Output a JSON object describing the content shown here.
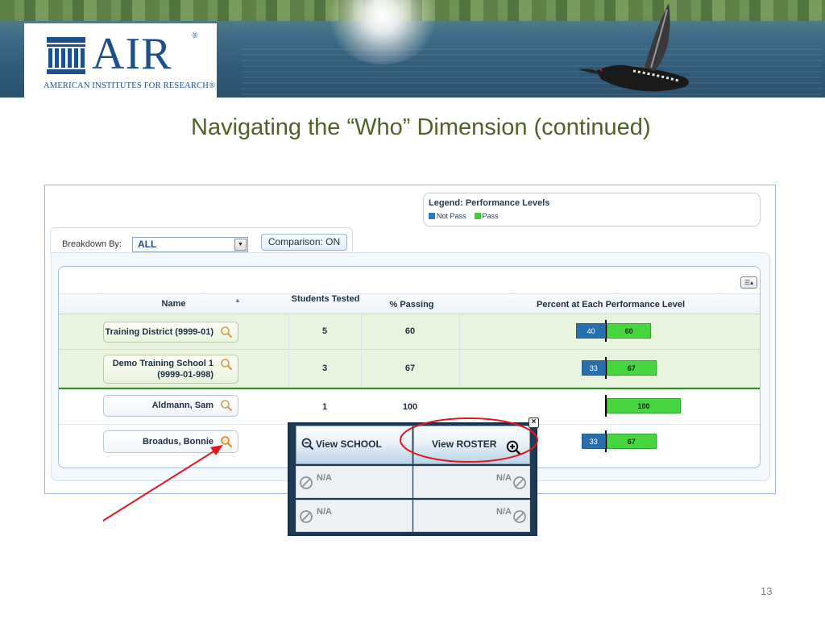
{
  "logo": {
    "mark": "AIR",
    "registered": "®",
    "subtitle": "AMERICAN INSTITUTES FOR RESEARCH®"
  },
  "slide": {
    "title": "Navigating the “Who” Dimension (continued)",
    "page_number": "13"
  },
  "legend": {
    "title": "Legend: Performance Levels",
    "items": [
      {
        "label": "Not Pass",
        "color": "#2a7bbd"
      },
      {
        "label": "Pass",
        "color": "#3fcf3f"
      }
    ]
  },
  "toolbar": {
    "breakdown_label": "Breakdown By:",
    "breakdown_value": "ALL",
    "comparison_label": "Comparison: ON"
  },
  "table": {
    "columns": {
      "name": "Name",
      "tested": "Students Tested",
      "passing": "% Passing",
      "levels": "Percent at Each Performance Level"
    },
    "rows": [
      {
        "name": "Training District (9999-01)",
        "tested": "5",
        "passing": "60",
        "not_pass": 40,
        "pass": 60,
        "not_pass_label": "40",
        "pass_label": "60"
      },
      {
        "name_line1": "Demo Training School 1",
        "name_line2": "(9999-01-998)",
        "tested": "3",
        "passing": "67",
        "not_pass": 33,
        "pass": 67,
        "not_pass_label": "33",
        "pass_label": "67"
      },
      {
        "name": "Aldmann, Sam",
        "tested": "1",
        "passing": "100",
        "not_pass": 0,
        "pass": 100,
        "pass_label": "100"
      },
      {
        "name": "Broadus, Bonnie",
        "not_pass": 33,
        "pass": 67,
        "not_pass_label": "33",
        "pass_label": "67"
      }
    ]
  },
  "popup": {
    "view_school": "View SCHOOL",
    "view_roster": "View ROSTER",
    "cells": [
      "N/A",
      "N/A",
      "N/A",
      "N/A"
    ],
    "close": "×"
  },
  "colors": {
    "brand_blue": "#1d4f8c",
    "title_green": "#4f6228",
    "not_pass": "#2a6fad",
    "pass": "#46d43f",
    "annotation_red": "#e3161c"
  }
}
